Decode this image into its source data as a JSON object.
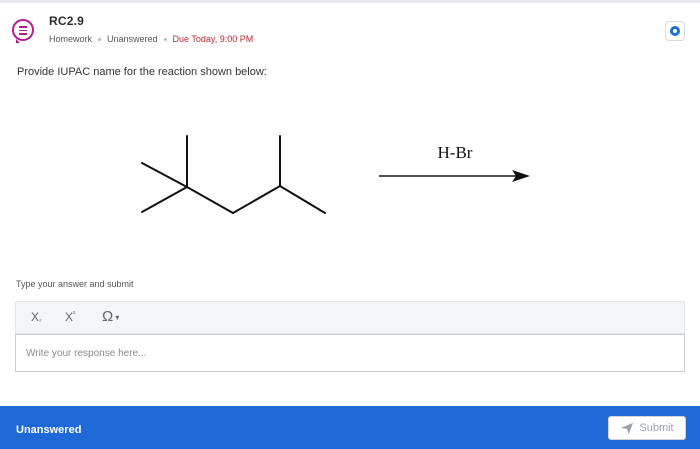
{
  "question": {
    "title": "RC2.9",
    "type": "Homework",
    "status": "Unanswered",
    "due": "Due Today, 9:00 PM",
    "prompt": "Provide IUPAC name for the reaction shown below:"
  },
  "reaction": {
    "reagent": "H-Br"
  },
  "answer": {
    "label": "Type your answer and submit",
    "toolbar": {
      "subscript": "X",
      "subscript_mark": "₂",
      "superscript": "X",
      "superscript_mark": "²",
      "symbols": "Ω",
      "symbols_caret": "▾"
    },
    "placeholder": "Write your response here..."
  },
  "footer": {
    "status": "Unanswered",
    "submit_label": "Submit"
  },
  "icons": {
    "question": "question-list-icon",
    "corner": "target-icon",
    "submit": "send-icon"
  },
  "colors": {
    "accent": "#1f69d6",
    "question_icon": "#b01e8c",
    "due": "#c0272d"
  }
}
